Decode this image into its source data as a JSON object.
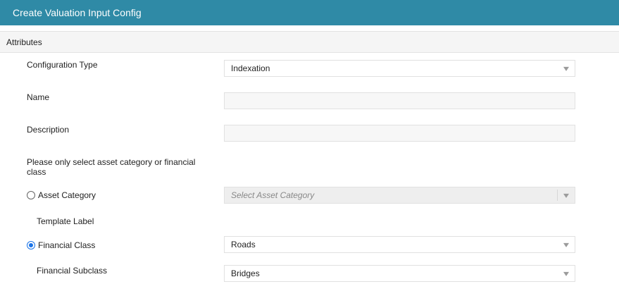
{
  "header": {
    "title": "Create Valuation Input Config"
  },
  "section": {
    "title": "Attributes"
  },
  "form": {
    "configuration_type": {
      "label": "Configuration Type",
      "value": "Indexation"
    },
    "name": {
      "label": "Name",
      "value": ""
    },
    "description": {
      "label": "Description",
      "value": ""
    },
    "note": "Please only select asset category or financial class",
    "asset_category": {
      "label": "Asset Category",
      "selected": false,
      "placeholder": "Select Asset Category"
    },
    "template_label": {
      "label": "Template Label"
    },
    "financial_class": {
      "label": "Financial Class",
      "selected": true,
      "value": "Roads"
    },
    "financial_subclass": {
      "label": "Financial Subclass",
      "value": "Bridges"
    }
  },
  "icons": {
    "dropdown": "caret-down-icon",
    "radio": "radio-icon"
  },
  "colors": {
    "header": "#2f8aa6",
    "radio_selected": "#1a73e8"
  }
}
